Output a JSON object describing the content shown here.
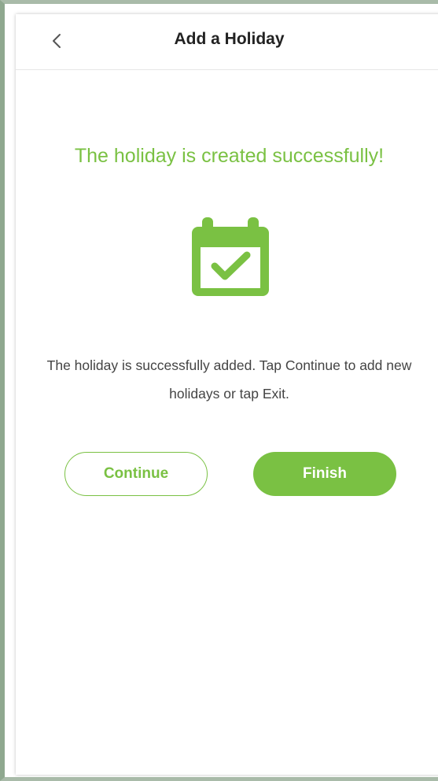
{
  "header": {
    "title": "Add a Holiday",
    "back_icon": "chevron-left-icon"
  },
  "main": {
    "success_title": "The holiday is created successfully!",
    "icon": "calendar-check-icon",
    "message_line1": "The holiday is successfully added. Tap Continue to add new",
    "message_line2": "holidays or tap Exit.",
    "continue_label": "Continue",
    "finish_label": "Finish"
  },
  "colors": {
    "accent": "#7ac143",
    "title_text": "#222222",
    "body_text": "#444444"
  }
}
